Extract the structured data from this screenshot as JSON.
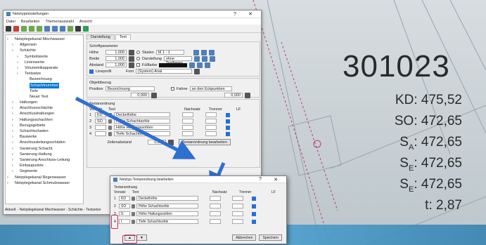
{
  "labels": {
    "shaft_id": "301023",
    "rows": [
      {
        "name": "KD",
        "sub": "",
        "sep": ":",
        "value": " 475,52"
      },
      {
        "name": "SO",
        "sub": "",
        "sep": ":",
        "value": " 472,65"
      },
      {
        "name": "S",
        "sub": "A",
        "sep": ":",
        "value": " 472,65"
      },
      {
        "name": "S",
        "sub": "E",
        "sep": ":",
        "value": " 472,65"
      },
      {
        "name": "S",
        "sub": "E",
        "sep": ":",
        "value": " 472,65"
      },
      {
        "name": "t",
        "sub": "",
        "sep": ":",
        "value": "   2,87"
      }
    ]
  },
  "main_window": {
    "title": "Netztypeinstellungen",
    "menu": [
      "Datei",
      "Bearbeiten",
      "Themenauswahl",
      "Ansicht"
    ],
    "tree": [
      {
        "label": "Netzplegekanal Mischwasser",
        "depth": 0,
        "color": "#7a9a3a"
      },
      {
        "label": "Allgemein",
        "depth": 1,
        "color": "#c8a850"
      },
      {
        "label": "Schächte",
        "depth": 1,
        "color": "#c8a850"
      },
      {
        "label": "Symbolisierte",
        "depth": 2,
        "color": "#c8a850"
      },
      {
        "label": "Linienwerte",
        "depth": 2,
        "color": "#c8a850"
      },
      {
        "label": "Volumetrikapparate",
        "depth": 2,
        "color": "#c8a850"
      },
      {
        "label": "Textsetze",
        "depth": 2,
        "color": "#c8a850"
      },
      {
        "label": "Bezeichnung",
        "depth": 3,
        "color": "#e0c060"
      },
      {
        "label": "Schachtnummer",
        "depth": 3,
        "color": "#e0c060",
        "selected": true
      },
      {
        "label": "Tiefe",
        "depth": 3,
        "color": "#e0c060"
      },
      {
        "label": "Neuer Text",
        "depth": 3,
        "color": "#e0c060"
      },
      {
        "label": "Haltungen",
        "depth": 1,
        "color": "#c8a850"
      },
      {
        "label": "Anschlussschächte",
        "depth": 1,
        "color": "#c8a850"
      },
      {
        "label": "Anschlusshaltungen",
        "depth": 1,
        "color": "#c8a850"
      },
      {
        "label": "Haltungsschachten",
        "depth": 1,
        "color": "#c8a850"
      },
      {
        "label": "Bezugsgebiete",
        "depth": 1,
        "color": "#c8a850"
      },
      {
        "label": "Schachtschaden",
        "depth": 1,
        "color": "#c8a850"
      },
      {
        "label": "Bauwerke",
        "depth": 1,
        "color": "#c8a850"
      },
      {
        "label": "Anschlussleitungsschäden",
        "depth": 1,
        "color": "#c8a850"
      },
      {
        "label": "Sanierung Schacht",
        "depth": 1,
        "color": "#c8a850"
      },
      {
        "label": "Sanierung Haltung",
        "depth": 1,
        "color": "#c8a850"
      },
      {
        "label": "Sanierung Anschluss-Leitung",
        "depth": 1,
        "color": "#c8a850"
      },
      {
        "label": "Einbaupunkte",
        "depth": 1,
        "color": "#c8a850"
      },
      {
        "label": "Segmente",
        "depth": 1,
        "color": "#c8a850"
      },
      {
        "label": "Netzplegekanal Regenwasser",
        "depth": 0,
        "color": "#7a9a3a"
      },
      {
        "label": "Netzplegekanal Schmutzwasser",
        "depth": 0,
        "color": "#7a9a3a"
      }
    ],
    "status": "Aktuell: - Netzplegekanal Mischwasser - Schächte - Textsetze",
    "tabs": [
      "Darstellung",
      "Text"
    ],
    "font_group": {
      "title": "Schriftparameter",
      "hoehe_label": "Höhe",
      "hoehe_value": "1,000",
      "skalen_label": "Skalen",
      "skalen_value": "M 1 : 1",
      "breite_label": "Breite",
      "breite_value": "1,000",
      "darstellung_label": "Darstellung",
      "darstellung_value": "ohne Textfreien",
      "abstand_label": "Abstand",
      "abstand_value": "1,000",
      "fuellfarbe_label": "Füllfarbe",
      "fuellfarbe_color": "#111111",
      "lineprofile_label": "Lineprofil",
      "font_label": "Font",
      "font_value": "(System) Arial"
    },
    "obj_group": {
      "title": "Objektbezug",
      "position_label": "Position",
      "position_value": "Bezeichnung",
      "fahne_label": "Fahne",
      "fahne_value": "an den Eckpunkten",
      "x_value": "0,000",
      "y_value": "0,000"
    },
    "text_group": {
      "title": "Textanordnung",
      "headers": [
        "Vorsatz",
        "Text",
        "Nachsatz",
        "Trenner",
        "LF"
      ],
      "rows": [
        {
          "nr": "1",
          "vorsatz": "KD",
          "text": "Deckelhöhe"
        },
        {
          "nr": "2",
          "vorsatz": "SO",
          "text": "Höhe Schachtsohle"
        },
        {
          "nr": "3",
          "vorsatz": "",
          "text": "Höhe Haltungssohlen"
        },
        {
          "nr": "4",
          "vorsatz": "",
          "text": "Tiefe Schachtsohle"
        }
      ],
      "zeilenabstand_label": "Zeilenabstand",
      "zeilenabstand_value": "0,000",
      "edit_button": "Textanordnung bearbeiten"
    }
  },
  "dialog": {
    "title": "Netztyp-Textanordnung bearbeiten",
    "group_title": "Textanordnung",
    "headers": [
      "Vorsatz",
      "Text",
      "Nachsatz",
      "Trenner",
      "LF"
    ],
    "rows": [
      {
        "nr": "1",
        "vorsatz": "KD",
        "text": "Deckelhöhe"
      },
      {
        "nr": "2",
        "vorsatz": "SO",
        "text": "Höhe Schachtsohle"
      },
      {
        "nr": "3",
        "vorsatz": "S",
        "text": "Höhe Haltungssohlen"
      },
      {
        "nr": "4",
        "vorsatz": "t",
        "text": "Tiefe Schachtsohle"
      }
    ],
    "cancel": "Abbrechen",
    "save": "Speichern"
  },
  "colors": {
    "arrow": "#2f6fd0",
    "highlight": "#d0286b",
    "selection": "#0078d7"
  }
}
